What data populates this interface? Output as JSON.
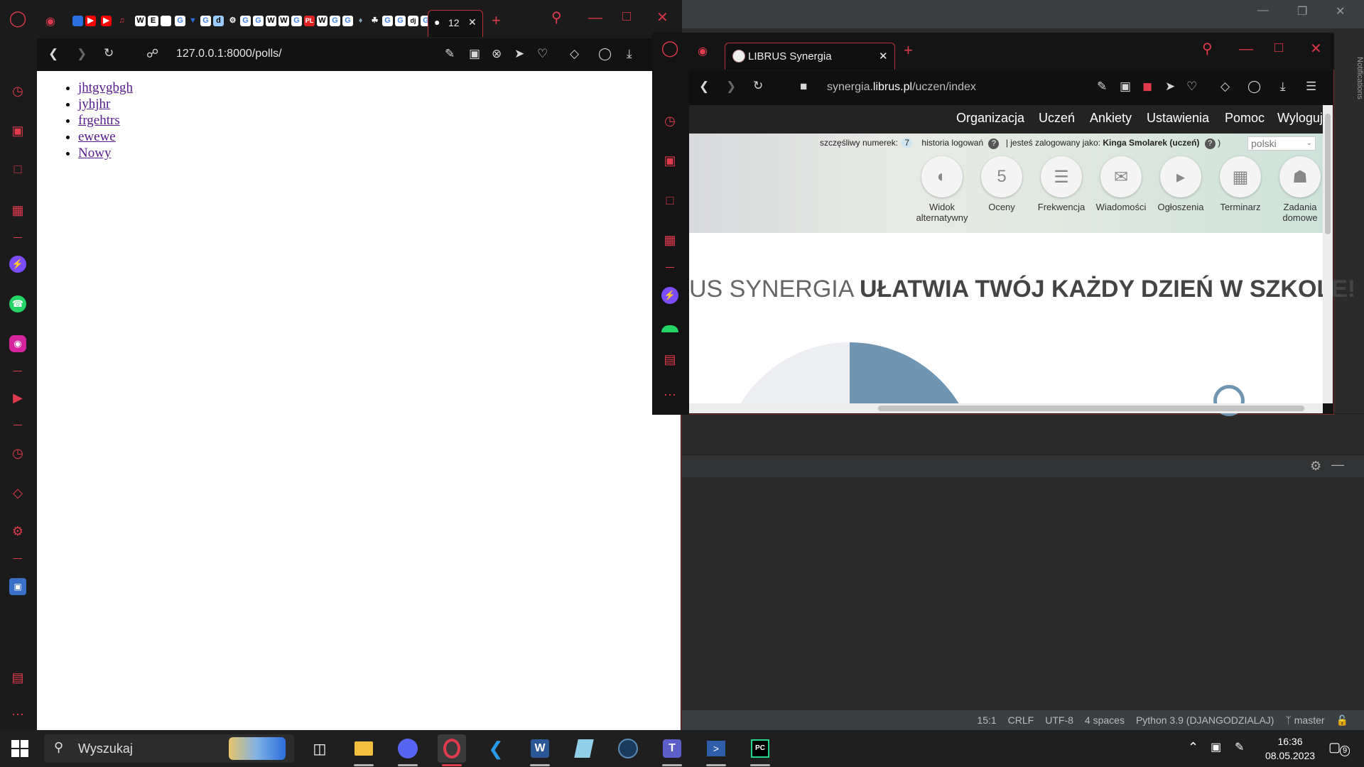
{
  "ide": {
    "status": {
      "position": "15:1",
      "line_sep": "CRLF",
      "encoding": "UTF-8",
      "indent": "4 spaces",
      "interpreter": "Python 3.9 (DJANGODZIALAJ)",
      "branch": "master"
    },
    "notifications_label": "Notifications"
  },
  "browser1": {
    "active_tab_label": "12",
    "address": "127.0.0.1:8000/polls/",
    "links": [
      "jhtgvgbgh",
      "jyhjhr",
      "frgehtrs",
      "ewewe",
      "Nowy"
    ],
    "accent_color": "#e03a4d"
  },
  "browser2": {
    "tab_title": "LIBRUS Synergia",
    "address_domain": "synergia.",
    "address_bold": "librus.pl",
    "address_path": "/uczen/index",
    "nav": [
      "Organizacja",
      "Uczeń",
      "Ankiety",
      "Ustawienia",
      "Pomoc",
      "Wyloguj"
    ],
    "info": {
      "lucky_label": "szczęśliwy numerek:",
      "lucky_number": "7",
      "history": "historia logowań",
      "logged_as": "| jesteś zalogowany jako:",
      "user": "Kinga Smolarek (uczeń)",
      "close_paren": ")",
      "language": "polski"
    },
    "tiles": [
      {
        "label": "Widok alternatywny",
        "icon": "contrast-icon"
      },
      {
        "label": "Oceny",
        "icon": "grades-icon"
      },
      {
        "label": "Frekwencja",
        "icon": "attendance-icon"
      },
      {
        "label": "Wiadomości",
        "icon": "mail-icon"
      },
      {
        "label": "Ogłoszenia",
        "icon": "megaphone-icon"
      },
      {
        "label": "Terminarz",
        "icon": "calendar-icon"
      },
      {
        "label": "Zadania domowe",
        "icon": "homework-icon"
      }
    ],
    "hero_light": "US SYNERGIA",
    "hero_bold": "UŁATWIA TWÓJ KAŻDY DZIEŃ W SZKOLE!"
  },
  "taskbar": {
    "search_placeholder": "Wyszukaj",
    "time": "16:36",
    "date": "08.05.2023",
    "notification_count": "9"
  }
}
